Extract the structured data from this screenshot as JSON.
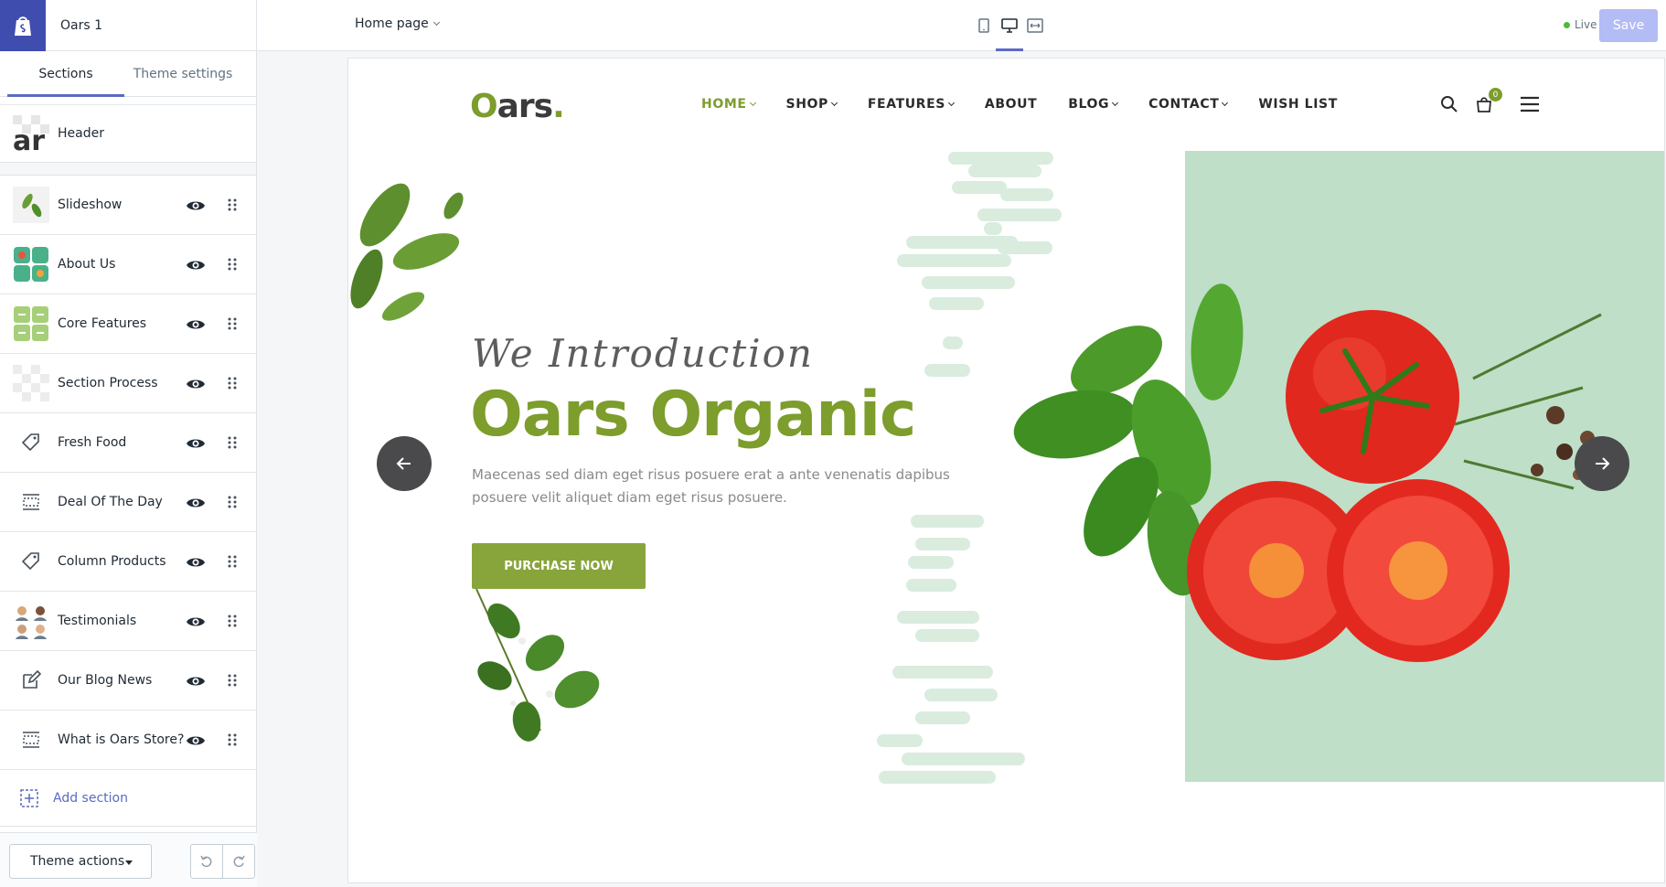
{
  "store": {
    "name": "Oars 1"
  },
  "sidebar": {
    "tabs": [
      {
        "label": "Sections"
      },
      {
        "label": "Theme settings"
      }
    ],
    "header_label": "Header",
    "sections": [
      {
        "label": "Slideshow",
        "icon": "slideshow-thumb"
      },
      {
        "label": "About Us",
        "icon": "about-thumb"
      },
      {
        "label": "Core Features",
        "icon": "features-thumb"
      },
      {
        "label": "Section Process",
        "icon": "transparent-thumb"
      },
      {
        "label": "Fresh Food",
        "icon": "tag-icon"
      },
      {
        "label": "Deal Of The Day",
        "icon": "layout-icon"
      },
      {
        "label": "Column Products",
        "icon": "tag-icon"
      },
      {
        "label": "Testimonials",
        "icon": "testimonials-thumb"
      },
      {
        "label": "Our Blog News",
        "icon": "edit-icon"
      },
      {
        "label": "What is Oars Store?",
        "icon": "layout-icon"
      }
    ],
    "add_section": "Add section",
    "theme_actions": "Theme actions"
  },
  "topbar": {
    "page": "Home page",
    "status": "Live",
    "save": "Save"
  },
  "preview": {
    "logo": {
      "o": "O",
      "rest": "ars",
      "dot": "."
    },
    "nav": [
      {
        "label": "HOME",
        "dropdown": true
      },
      {
        "label": "SHOP",
        "dropdown": true
      },
      {
        "label": "FEATURES",
        "dropdown": true
      },
      {
        "label": "ABOUT",
        "dropdown": false
      },
      {
        "label": "BLOG",
        "dropdown": true
      },
      {
        "label": "CONTACT",
        "dropdown": true
      },
      {
        "label": "WISH LIST",
        "dropdown": false
      }
    ],
    "cart_count": "0",
    "hero": {
      "eyebrow": "We Introduction",
      "title": "Oars Organic",
      "text": "Maecenas sed diam eget risus posuere erat a ante venenatis dapibus posuere velit aliquet diam eget risus posuere.",
      "cta": "PURCHASE NOW"
    }
  },
  "colors": {
    "accent": "#5c6ac4",
    "brand_green": "#7d9d2c",
    "hero_bg": "#bfdfc8",
    "live_dot": "#50b83c"
  }
}
